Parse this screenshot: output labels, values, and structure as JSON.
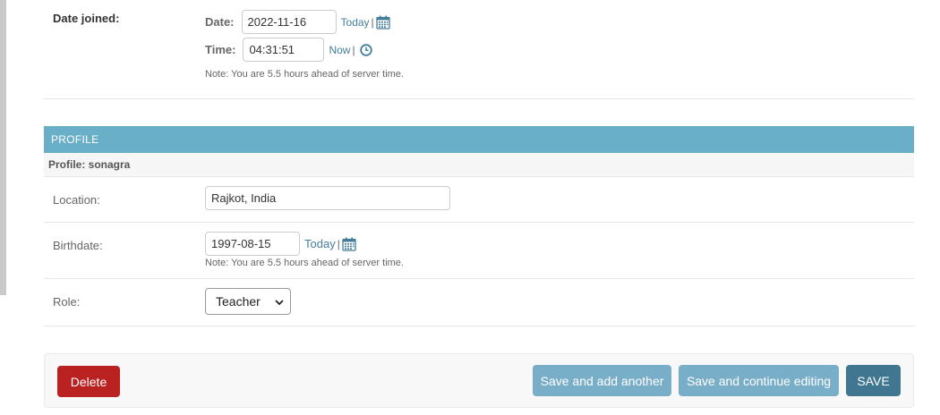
{
  "date_joined": {
    "label": "Date joined:",
    "date_label": "Date:",
    "date_value": "2022-11-16",
    "today_link": "Today",
    "time_label": "Time:",
    "time_value": "04:31:51",
    "now_link": "Now",
    "separator": "|",
    "note": "Note: You are 5.5 hours ahead of server time."
  },
  "profile": {
    "header": "PROFILE",
    "subheader": "Profile: sonagra",
    "location_label": "Location:",
    "location_value": "Rajkot, India",
    "birthdate_label": "Birthdate:",
    "birthdate_value": "1997-08-15",
    "birthdate_today": "Today",
    "separator": "|",
    "birthdate_note": "Note: You are 5.5 hours ahead of server time.",
    "role_label": "Role:",
    "role_value": "Teacher"
  },
  "actions": {
    "delete": "Delete",
    "save_add_another": "Save and add another",
    "save_continue": "Save and continue editing",
    "save": "SAVE"
  },
  "colors": {
    "header_bg": "#6aafc8",
    "link": "#447e9b",
    "delete": "#ba2121",
    "save_light": "#79aec8",
    "save_primary": "#417690"
  }
}
